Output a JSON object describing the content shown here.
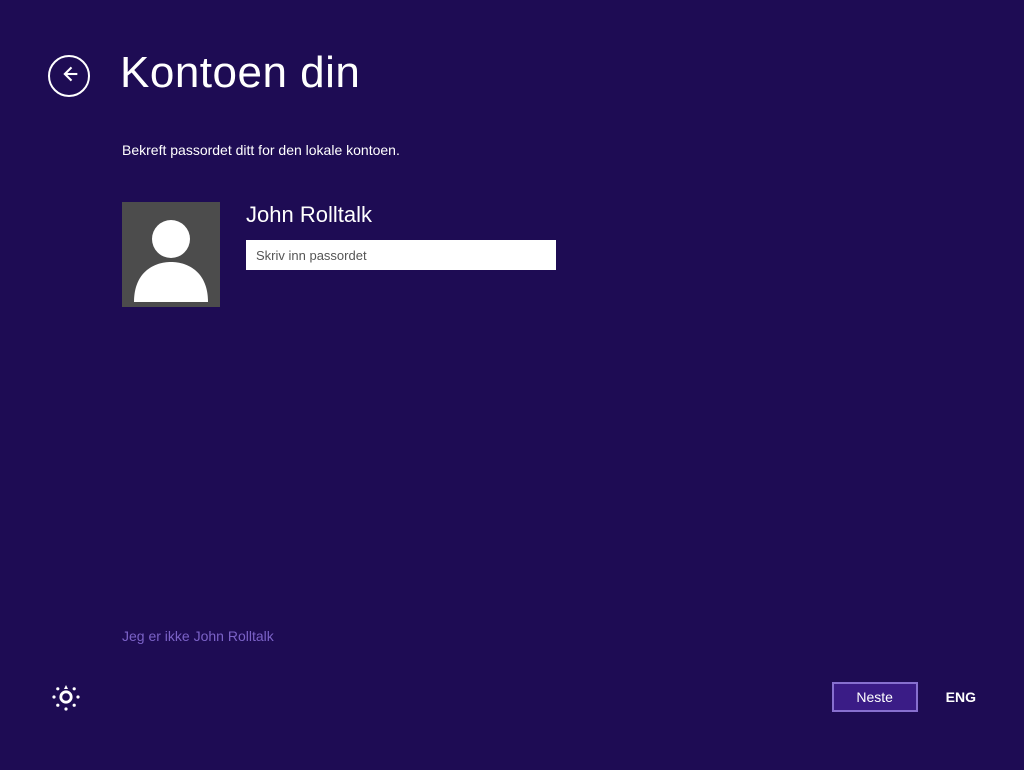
{
  "header": {
    "title": "Kontoen din"
  },
  "content": {
    "subtitle": "Bekreft passordet ditt for den lokale kontoen.",
    "username": "John Rolltalk",
    "password_placeholder": "Skriv inn passordet"
  },
  "links": {
    "not_me": "Jeg er ikke John Rolltalk"
  },
  "footer": {
    "next_label": "Neste",
    "language": "ENG"
  }
}
